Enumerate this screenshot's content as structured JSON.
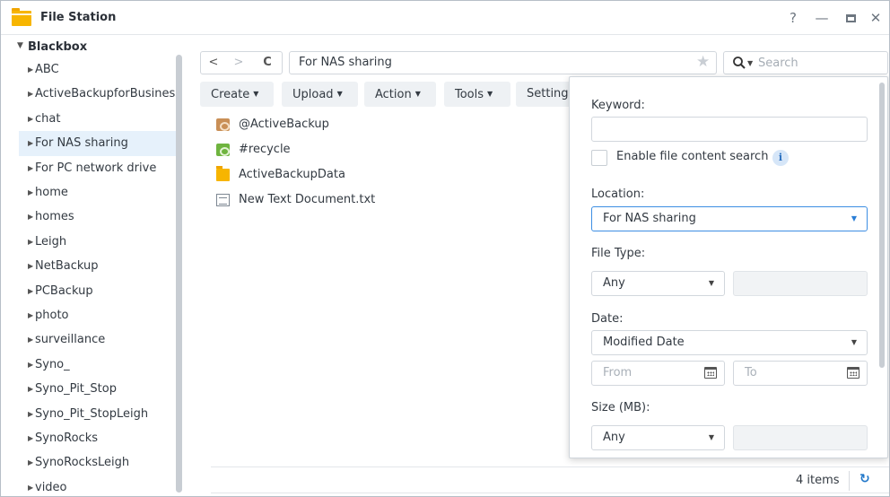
{
  "window": {
    "title": "File Station",
    "help_label": "?",
    "minimize_label": "—",
    "close_label": "✕"
  },
  "sidebar": {
    "root": "Blackbox",
    "items": [
      {
        "label": "ABC"
      },
      {
        "label": "ActiveBackupforBusiness"
      },
      {
        "label": "chat"
      },
      {
        "label": "For NAS sharing",
        "selected": true
      },
      {
        "label": "For PC network drive"
      },
      {
        "label": "home"
      },
      {
        "label": "homes"
      },
      {
        "label": "Leigh"
      },
      {
        "label": "NetBackup"
      },
      {
        "label": "PCBackup"
      },
      {
        "label": "photo"
      },
      {
        "label": "surveillance"
      },
      {
        "label": "Syno_"
      },
      {
        "label": "Syno_Pit_Stop"
      },
      {
        "label": "Syno_Pit_StopLeigh"
      },
      {
        "label": "SynoRocks"
      },
      {
        "label": "SynoRocksLeigh"
      },
      {
        "label": "video"
      }
    ]
  },
  "toolbar": {
    "back": "<",
    "forward": ">",
    "refresh": "C",
    "path": "For NAS sharing",
    "search_placeholder": "Search",
    "create": "Create",
    "upload": "Upload",
    "action": "Action",
    "tools": "Tools",
    "settings": "Settings"
  },
  "files": [
    {
      "name": "@ActiveBackup",
      "icon": "activebackup-folder-icon"
    },
    {
      "name": "#recycle",
      "icon": "recycle-folder-icon"
    },
    {
      "name": "ActiveBackupData",
      "icon": "folder-icon"
    },
    {
      "name": "New Text Document.txt",
      "icon": "text-file-icon"
    }
  ],
  "status": {
    "item_count": "4 items"
  },
  "search_panel": {
    "keyword_label": "Keyword:",
    "keyword_value": "",
    "content_search_label": "Enable file content search",
    "info_glyph": "i",
    "location_label": "Location:",
    "location_value": "For NAS sharing",
    "file_type_label": "File Type:",
    "file_type_value": "Any",
    "date_label": "Date:",
    "date_type_value": "Modified Date",
    "from_placeholder": "From",
    "to_placeholder": "To",
    "size_label": "Size (MB):",
    "size_value": "Any"
  },
  "colors": {
    "accent": "#1f76c9",
    "selected_bg": "#e6f1fb",
    "folder": "#f7b500",
    "button_bg": "#eef1f4"
  }
}
